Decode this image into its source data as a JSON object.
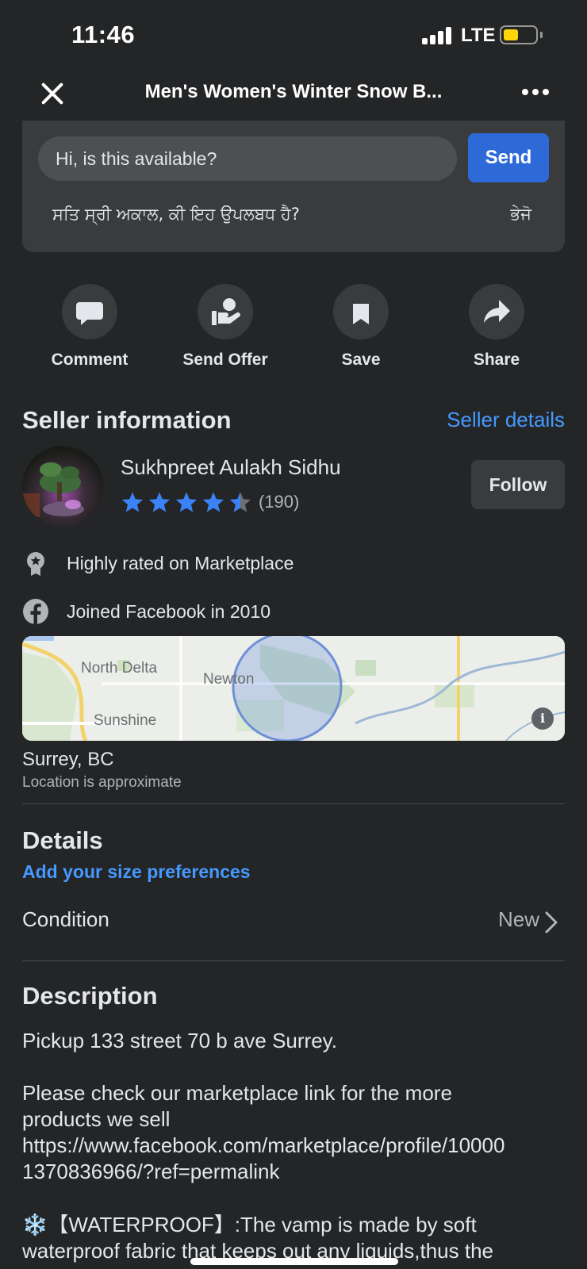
{
  "status_bar": {
    "time": "11:46",
    "network": "LTE"
  },
  "nav": {
    "title": "Men's Women's Winter Snow B..."
  },
  "message": {
    "input_value": "Hi, is this available?",
    "send_label": "Send",
    "translation": "ਸਤਿ ਸ੍ਰੀ ਅਕਾਲ, ਕੀ ਇਹ ਉਪਲਬਧ ਹੈ?",
    "translation_send": "ਭੇਜੋ"
  },
  "actions": [
    {
      "label": "Comment",
      "icon": "comment-icon"
    },
    {
      "label": "Send Offer",
      "icon": "send-offer-icon"
    },
    {
      "label": "Save",
      "icon": "bookmark-icon"
    },
    {
      "label": "Share",
      "icon": "share-icon"
    }
  ],
  "seller": {
    "section_title": "Seller information",
    "details_link": "Seller details",
    "name": "Sukhpreet Aulakh Sidhu",
    "rating": 4.5,
    "rating_count": "(190)",
    "follow_label": "Follow",
    "badges": [
      {
        "icon": "award-icon",
        "text": "Highly rated on Marketplace"
      },
      {
        "icon": "facebook-icon",
        "text": "Joined Facebook in 2010"
      }
    ]
  },
  "map": {
    "labels": [
      "North Delta",
      "Newton",
      "Sunshine"
    ]
  },
  "location": {
    "city": "Surrey, BC",
    "note": "Location is approximate"
  },
  "details": {
    "title": "Details",
    "size_pref_link": "Add your size preferences",
    "condition_label": "Condition",
    "condition_value": "New"
  },
  "description": {
    "title": "Description",
    "line1": "Pickup 133 street 70 b ave Surrey.",
    "line2": "Please check our marketplace link for the more products we sell",
    "link": "https://www.facebook.com/marketplace/profile/100001370836966/?ref=permalink",
    "line3": "❄️【WATERPROOF】:The vamp is made by soft waterproof fabric that keeps out any liquids,thus the"
  },
  "colors": {
    "background": "#242526",
    "accent": "#2d6ad8",
    "link": "#4599ff",
    "star": "#3b82f6"
  }
}
